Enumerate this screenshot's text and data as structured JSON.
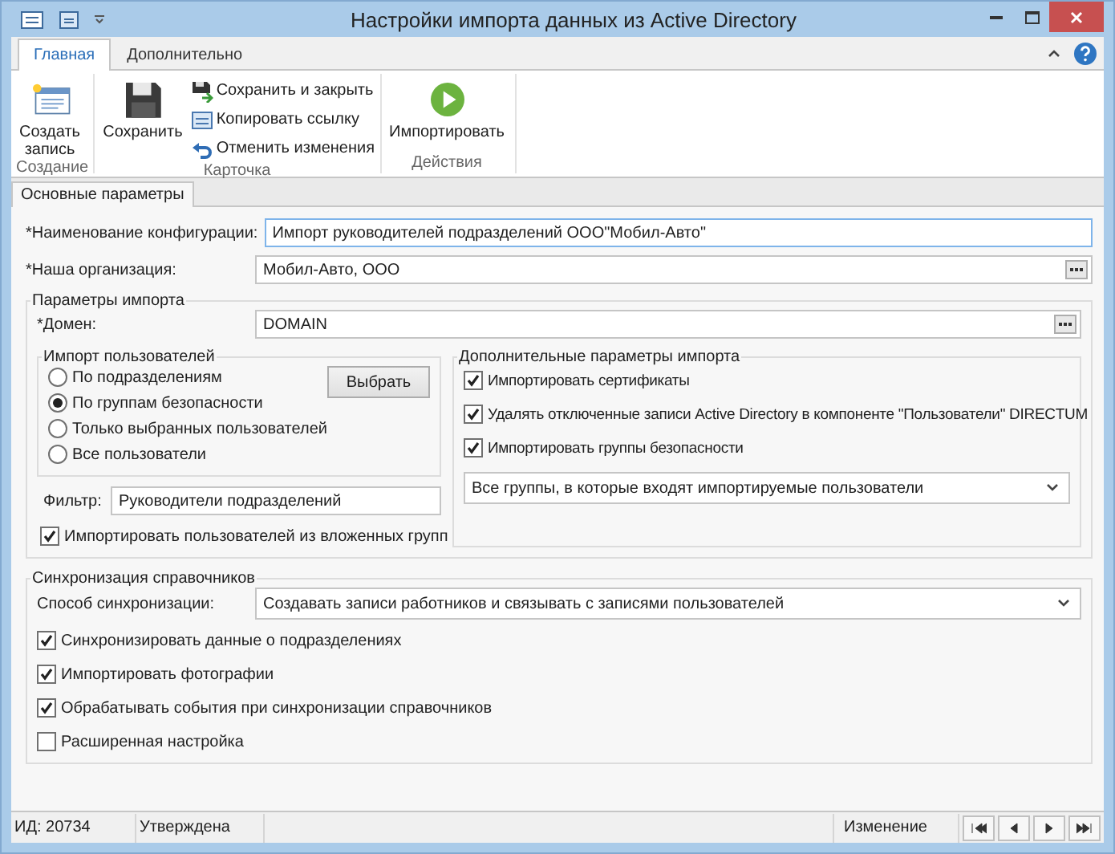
{
  "window": {
    "title": "Настройки импорта данных из Active Directory"
  },
  "ribbon": {
    "tabs": [
      {
        "label": "Главная",
        "selected": true
      },
      {
        "label": "Дополнительно",
        "selected": false
      }
    ],
    "groups": [
      {
        "label": "Создание",
        "buttons": [
          {
            "label": "Создать запись",
            "kind": "large"
          }
        ]
      },
      {
        "label": "Карточка",
        "buttons": [
          {
            "label": "Сохранить",
            "kind": "large"
          },
          {
            "label": "Сохранить и закрыть",
            "kind": "small"
          },
          {
            "label": "Копировать ссылку",
            "kind": "small"
          },
          {
            "label": "Отменить изменения",
            "kind": "small"
          }
        ]
      },
      {
        "label": "Действия",
        "buttons": [
          {
            "label": "Импортировать",
            "kind": "large"
          }
        ]
      }
    ]
  },
  "document_tabs": [
    {
      "label": "Основные параметры",
      "selected": true
    }
  ],
  "fields": [
    {
      "label": "*Наименование конфигурации:",
      "value": "Импорт руководителей подразделений ООО\"Мобил-Авто\"",
      "kind": "text",
      "focused": true
    },
    {
      "label": "*Наша организация:",
      "value": "Мобил-Авто, ООО",
      "kind": "lookup",
      "focused": false
    }
  ],
  "import_params": {
    "title": "Параметры импорта",
    "domain": {
      "label": "*Домен:",
      "value": "DOMAIN"
    },
    "users": {
      "title": "Импорт пользователей",
      "button": "Выбрать",
      "options": [
        {
          "label": "По подразделениям",
          "selected": false
        },
        {
          "label": "По группам безопасности",
          "selected": true
        },
        {
          "label": "Только выбранных пользователей",
          "selected": false
        },
        {
          "label": "Все пользователи",
          "selected": false
        }
      ]
    },
    "filter": {
      "label": "Фильтр:",
      "value": "Руководители подразделений"
    },
    "nested": {
      "label": "Импортировать пользователей из вложенных групп",
      "checked": true
    },
    "extra": {
      "title": "Дополнительные параметры импорта",
      "options": [
        {
          "label": "Импортировать сертификаты",
          "checked": true
        },
        {
          "label": "Удалять отключенные записи Active Directory в компоненте \"Пользователи\" DIRECTUM",
          "checked": true
        },
        {
          "label": "Импортировать группы безопасности",
          "checked": true
        }
      ],
      "groups_select": "Все группы, в которые входят импортируемые пользователи"
    }
  },
  "sync": {
    "title": "Синхронизация справочников",
    "method": {
      "label": "Способ синхронизации:",
      "value": "Создавать записи работников и связывать с записями пользователей"
    },
    "options": [
      {
        "label": "Синхронизировать данные о подразделениях",
        "checked": true
      },
      {
        "label": "Импортировать фотографии",
        "checked": true
      },
      {
        "label": "Обрабатывать события при синхронизации справочников",
        "checked": true
      },
      {
        "label": "Расширенная настройка",
        "checked": false
      }
    ]
  },
  "status_bar": {
    "id": "ИД: 20734",
    "state": "Утверждена",
    "mode": "Изменение"
  }
}
